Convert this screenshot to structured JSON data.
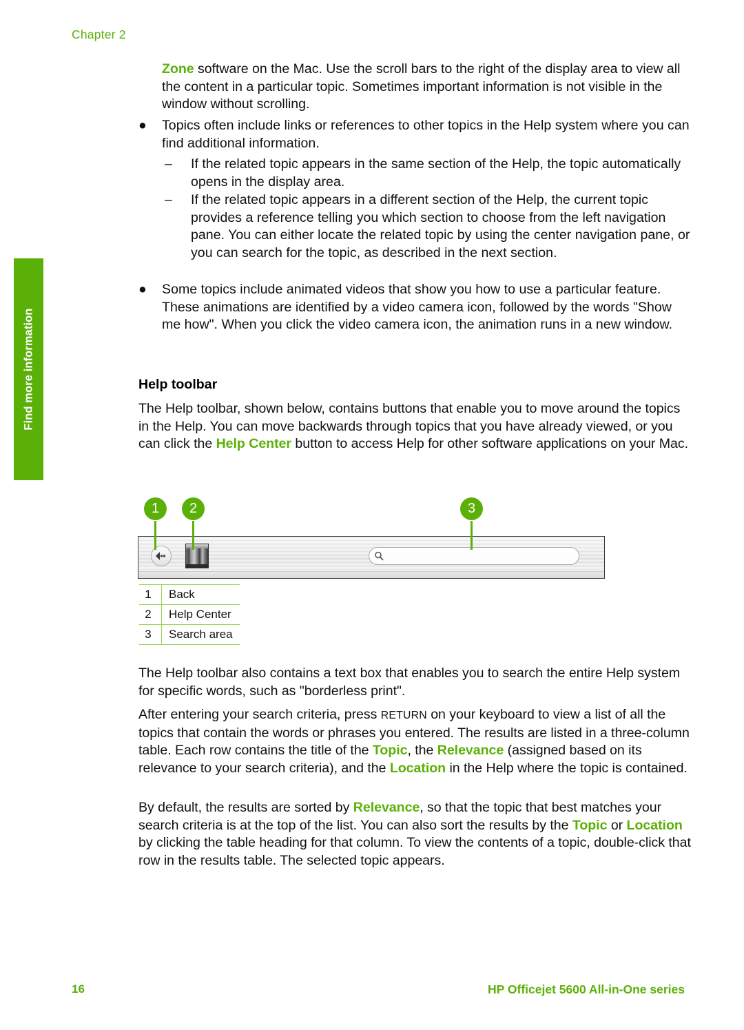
{
  "page": {
    "chapter_label": "Chapter 2",
    "side_tab_label": "Find more information",
    "footer_page_number": "16",
    "footer_product": "HP Officejet 5600 All-in-One series",
    "accent_color": "#5bb008",
    "rule_color": "#9ad45f",
    "text_color": "#111111"
  },
  "body": {
    "intro_paragraph": {
      "lead_highlight": "Zone",
      "rest": " software on the Mac. Use the scroll bars to the right of the display area to view all the content in a particular topic. Sometimes important information is not visible in the window without scrolling."
    },
    "bullets": [
      {
        "marker": "●",
        "text": "Topics often include links or references to other topics in the Help system where you can find additional information.",
        "sub_items": [
          {
            "marker": "–",
            "text": "If the related topic appears in the same section of the Help, the topic automatically opens in the display area."
          },
          {
            "marker": "–",
            "text": "If the related topic appears in a different section of the Help, the current topic provides a reference telling you which section to choose from the left navigation pane. You can either locate the related topic by using the center navigation pane, or you can search for the topic, as described in the next section."
          }
        ]
      },
      {
        "marker": "●",
        "text": "Some topics include animated videos that show you how to use a particular feature. These animations are identified by a video camera icon, followed by the words \"Show me how\". When you click the video camera icon, the animation runs in a new window.",
        "sub_items": []
      }
    ],
    "section_heading": "Help toolbar",
    "toolbar_paragraph": {
      "part1": "The Help toolbar, shown below, contains buttons that enable you to move around the topics in the Help. You can move backwards through topics that you have already viewed, or you can click the ",
      "highlight": "Help Center",
      "part2": " button to access Help for other software applications on your Mac."
    },
    "after_figure_paragraph": "The Help toolbar also contains a text box that enables you to search the entire Help system for specific words, such as \"borderless print\".",
    "search_paragraph": {
      "part1": "After entering your search criteria, press ",
      "key": "RETURN",
      "part2": " on your keyboard to view a list of all the topics that contain the words or phrases you entered. The results are listed in a three-column table. Each row contains the title of the ",
      "highlight1": "Topic",
      "part3": ", the ",
      "highlight2": "Relevance",
      "part4": " (assigned based on its relevance to your search criteria), and the ",
      "highlight3": "Location",
      "part5": " in the Help where the topic is contained."
    },
    "sort_paragraph": {
      "part1": "By default, the results are sorted by ",
      "highlight1": "Relevance",
      "part2": ", so that the topic that best matches your search criteria is at the top of the list. You can also sort the results by the ",
      "highlight2": "Topic",
      "part3": " or ",
      "highlight3": "Location",
      "part4": " by clicking the table heading for that column. To view the contents of a topic, double-click that row in the results table. The selected topic appears."
    }
  },
  "figure": {
    "callouts": [
      {
        "number": "1",
        "target": "back-button"
      },
      {
        "number": "2",
        "target": "help-center-button"
      },
      {
        "number": "3",
        "target": "search-area"
      }
    ],
    "toolbar_icons": {
      "back": "back-arrow-icon",
      "help_center": "help-center-books-icon",
      "search": "search-magnifier-icon"
    },
    "legend_rows": [
      {
        "number": "1",
        "label": "Back"
      },
      {
        "number": "2",
        "label": "Help Center"
      },
      {
        "number": "3",
        "label": "Search area"
      }
    ]
  }
}
